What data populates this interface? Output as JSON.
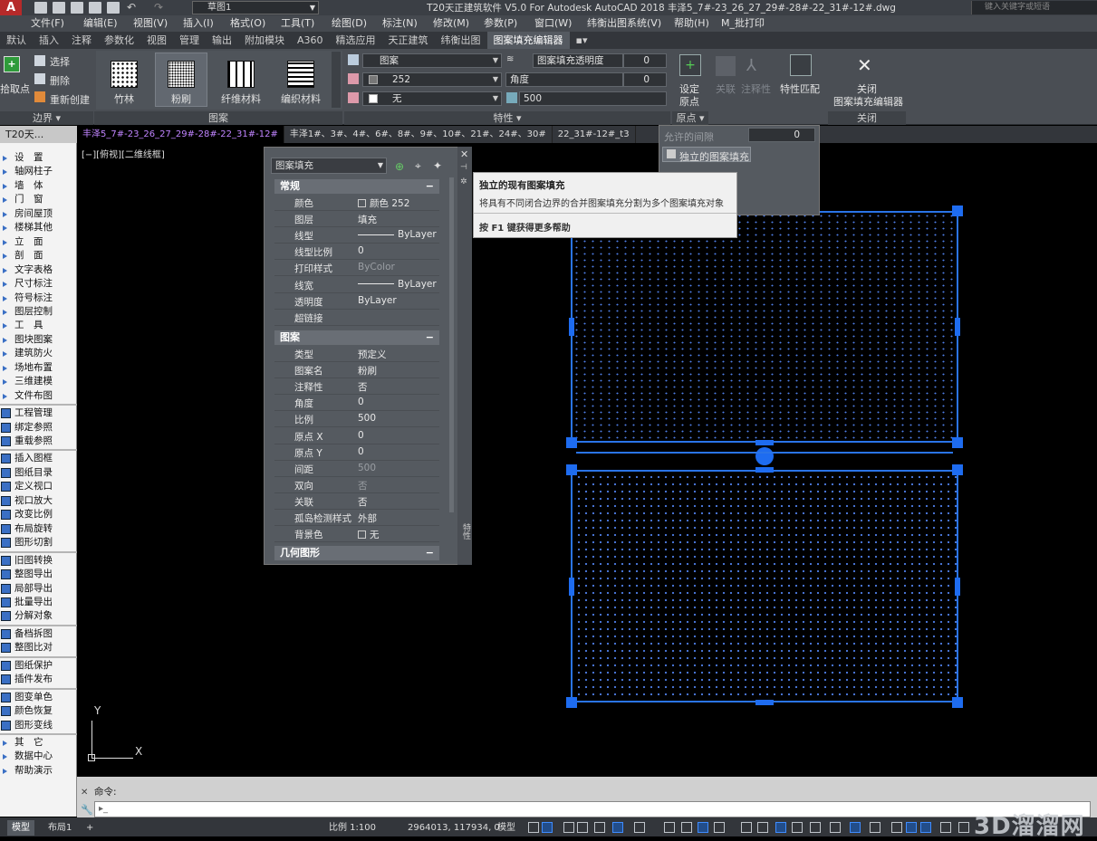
{
  "title": {
    "workspace": "草图1",
    "text": "T20天正建筑软件 V5.0 For Autodesk AutoCAD 2018    丰泽5_7#-23_26_27_29#-28#-22_31#-12#.dwg",
    "search_placeholder": "键入关键字或短语"
  },
  "menu": [
    "文件(F)",
    "编辑(E)",
    "视图(V)",
    "插入(I)",
    "格式(O)",
    "工具(T)",
    "绘图(D)",
    "标注(N)",
    "修改(M)",
    "参数(P)",
    "窗口(W)",
    "纬衡出图系统(V)",
    "帮助(H)",
    "M_批打印"
  ],
  "ribbon_tabs": [
    "默认",
    "插入",
    "注释",
    "参数化",
    "视图",
    "管理",
    "输出",
    "附加模块",
    "A360",
    "精选应用",
    "天正建筑",
    "纬衡出图",
    "图案填充编辑器"
  ],
  "ribbon": {
    "boundary": {
      "pick_label": "拾取点",
      "select_label": "选择",
      "remove_label": "删除",
      "recreate_label": "重新创建",
      "title": "边界"
    },
    "pattern": {
      "items": [
        "竹林",
        "粉刷",
        "纤维材料",
        "编织材料"
      ],
      "active": "粉刷",
      "title": "图案"
    },
    "properties": {
      "type": "图案",
      "color": "252",
      "background": "无",
      "transparency_label": "图案填充透明度",
      "transparency_value": "0",
      "angle_label": "角度",
      "angle_value": "0",
      "scale_value": "500",
      "title": "特性"
    },
    "origin": {
      "set_label": "设定",
      "set_label2": "原点",
      "title": "原点"
    },
    "options": {
      "assoc_label": "关联",
      "annotative_label": "注释性",
      "match_label": "特性匹配"
    },
    "close": {
      "label1": "关闭",
      "label2": "图案填充编辑器",
      "title": "关闭"
    }
  },
  "doc_tabs": [
    "丰泽5_7#-23_26_27_29#-28#-22_31#-12#",
    "丰泽1#、3#、4#、6#、8#、9#、10#、21#、24#、30#",
    "22_31#-12#_t3"
  ],
  "left_palette": {
    "header": "T20天...",
    "groupA": [
      "设　置",
      "轴网柱子",
      "墙　体",
      "门　窗",
      "房间屋顶",
      "楼梯其他",
      "立　面",
      "剖　面",
      "文字表格",
      "尺寸标注",
      "符号标注",
      "图层控制",
      "工　具",
      "图块图案",
      "建筑防火",
      "场地布置",
      "三维建模",
      "文件布图"
    ],
    "groupB": [
      "工程管理",
      "绑定参照",
      "重载参照"
    ],
    "groupC": [
      "插入图框",
      "图纸目录",
      "定义视口",
      "视口放大",
      "改变比例",
      "布局旋转",
      "图形切割"
    ],
    "groupD": [
      "旧图转换",
      "整图导出",
      "局部导出",
      "批量导出",
      "分解对象"
    ],
    "groupE": [
      "备档拆图",
      "整图比对"
    ],
    "groupF": [
      "图纸保护",
      "插件发布"
    ],
    "groupG": [
      "图变单色",
      "颜色恢复",
      "图形变线"
    ],
    "groupH": [
      "其　它",
      "数据中心",
      "帮助演示"
    ]
  },
  "viewport_label": "[−][俯视][二维线框]",
  "properties_palette": {
    "selector": "图案填充",
    "general_title": "常规",
    "general": [
      {
        "name": "颜色",
        "value": "颜色 252"
      },
      {
        "name": "图层",
        "value": "填充"
      },
      {
        "name": "线型",
        "value": "ByLayer"
      },
      {
        "name": "线型比例",
        "value": "0"
      },
      {
        "name": "打印样式",
        "value": "ByColor"
      },
      {
        "name": "线宽",
        "value": "ByLayer"
      },
      {
        "name": "透明度",
        "value": "ByLayer"
      },
      {
        "name": "超链接",
        "value": ""
      }
    ],
    "pattern_title": "图案",
    "pattern": [
      {
        "name": "类型",
        "value": "预定义"
      },
      {
        "name": "图案名",
        "value": "粉刷"
      },
      {
        "name": "注释性",
        "value": "否"
      },
      {
        "name": "角度",
        "value": "0"
      },
      {
        "name": "比例",
        "value": "500"
      },
      {
        "name": "原点 X",
        "value": "0"
      },
      {
        "name": "原点 Y",
        "value": "0"
      },
      {
        "name": "间距",
        "value": "500"
      },
      {
        "name": "双向",
        "value": "否"
      },
      {
        "name": "关联",
        "value": "否"
      },
      {
        "name": "孤岛检测样式",
        "value": "外部"
      },
      {
        "name": "背景色",
        "value": "无"
      }
    ],
    "geometry_title": "几何图形",
    "side_label": "特性"
  },
  "tooltip": {
    "title": "独立的现有图案填充",
    "desc": "将具有不同闭合边界的合并图案填充分割为多个图案填充对象",
    "help": "按 F1 键获得更多帮助"
  },
  "dropdown": {
    "gap_label": "允许的间隙",
    "gap_value": "0",
    "separate_label": "独立的图案填充"
  },
  "command": {
    "label": "命令:"
  },
  "status": {
    "tabs": [
      "模型",
      "布局1"
    ],
    "scale": "比例 1:100",
    "coords": "2964013, 117934, 0",
    "mode": "模型"
  },
  "watermark": "3D溜溜网",
  "colors": {
    "hatch_dots": "#4f7fe8",
    "grip": "#1e6cf0",
    "ribbon_bg": "#4a4e54"
  }
}
